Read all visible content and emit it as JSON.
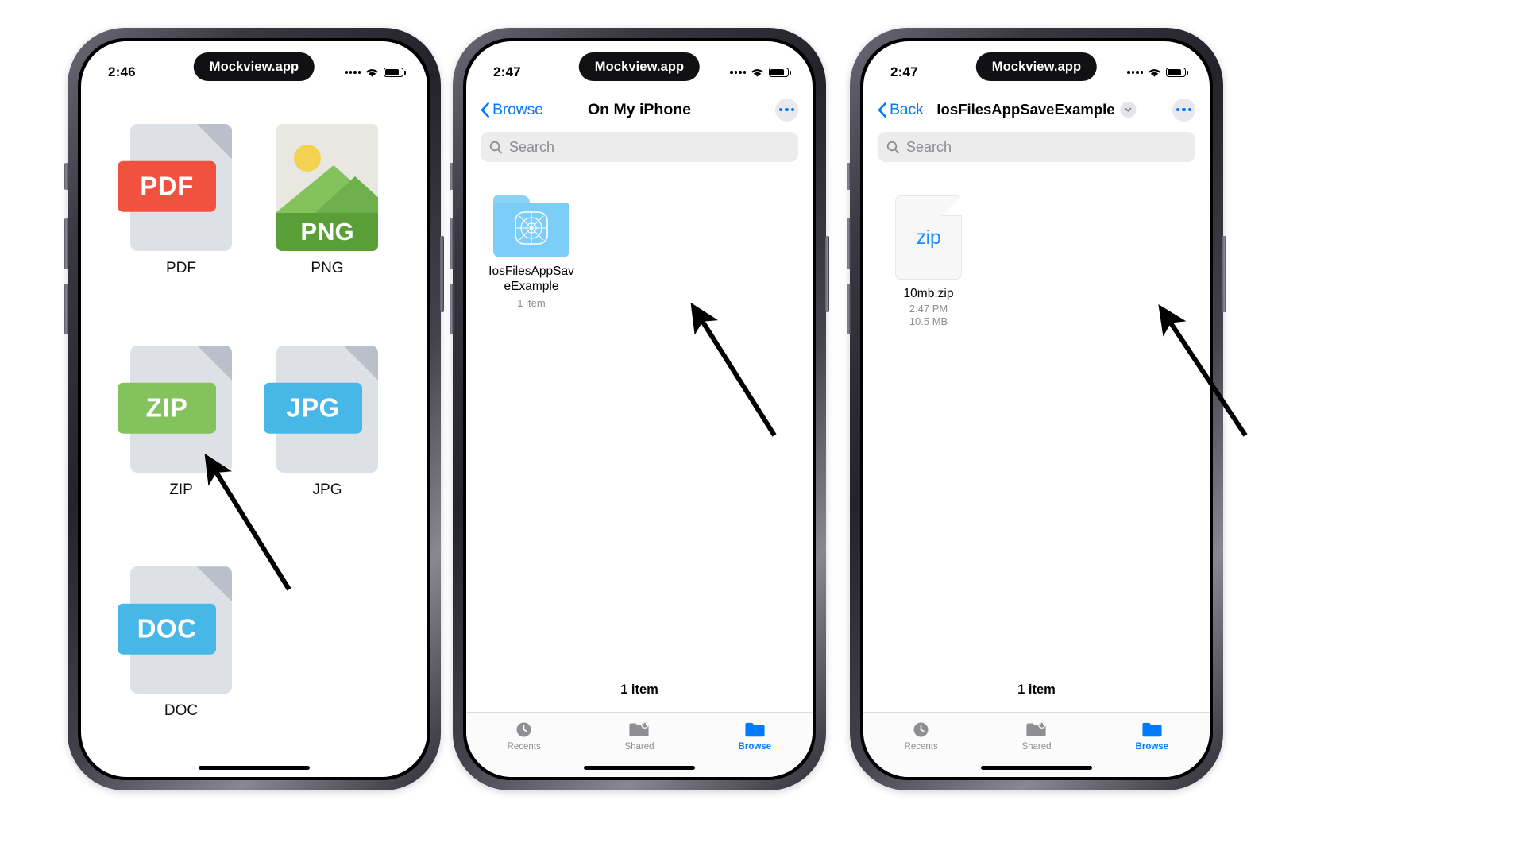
{
  "phones": [
    {
      "id": "phone-filetypes",
      "status": {
        "time": "2:46",
        "island_label": "Mockview.app",
        "wifi_icon": "wifi-icon",
        "battery_icon": "battery-icon",
        "signal_icon": "signal-dots-icon"
      },
      "filetypes": [
        {
          "label": "PDF",
          "badge": "PDF",
          "color": "#f0523f",
          "icon": "pdf-file-icon",
          "kind": "doc"
        },
        {
          "label": "PNG",
          "badge": "PNG",
          "color": "#5a9e38",
          "icon": "png-image-icon",
          "kind": "image"
        },
        {
          "label": "ZIP",
          "badge": "ZIP",
          "color": "#83c25d",
          "icon": "zip-file-icon",
          "kind": "doc"
        },
        {
          "label": "JPG",
          "badge": "JPG",
          "color": "#47b7e8",
          "icon": "jpg-file-icon",
          "kind": "doc"
        },
        {
          "label": "DOC",
          "badge": "DOC",
          "color": "#47b7e8",
          "icon": "doc-file-icon",
          "kind": "doc"
        }
      ]
    },
    {
      "id": "phone-on-my-iphone",
      "status": {
        "time": "2:47",
        "island_label": "Mockview.app",
        "wifi_icon": "wifi-icon",
        "battery_icon": "battery-icon",
        "signal_icon": "signal-dots-icon"
      },
      "nav": {
        "back_label": "Browse",
        "title": "On My iPhone",
        "more_icon": "ellipsis-circle-icon",
        "back_icon": "chevron-left-icon"
      },
      "search": {
        "placeholder": "Search",
        "icon": "search-icon"
      },
      "item": {
        "name": "IosFilesAppSaveExample",
        "subtitle": "1 item",
        "icon": "folder-icon"
      },
      "footer_count": "1 item",
      "tabs": [
        {
          "label": "Recents",
          "icon": "clock-icon",
          "active": false
        },
        {
          "label": "Shared",
          "icon": "shared-folder-icon",
          "active": false
        },
        {
          "label": "Browse",
          "icon": "folder-filled-icon",
          "active": true
        }
      ]
    },
    {
      "id": "phone-folder-contents",
      "status": {
        "time": "2:47",
        "island_label": "Mockview.app",
        "wifi_icon": "wifi-icon",
        "battery_icon": "battery-icon",
        "signal_icon": "signal-dots-icon"
      },
      "nav": {
        "back_label": "Back",
        "title": "IosFilesAppSaveExample",
        "more_icon": "ellipsis-circle-icon",
        "back_icon": "chevron-left-icon",
        "title_chevron_icon": "chevron-down-icon"
      },
      "search": {
        "placeholder": "Search",
        "icon": "search-icon"
      },
      "item": {
        "name": "10mb.zip",
        "time": "2:47 PM",
        "size": "10.5 MB",
        "icon": "zip-document-icon",
        "icon_label": "zip"
      },
      "footer_count": "1 item",
      "tabs": [
        {
          "label": "Recents",
          "icon": "clock-icon",
          "active": false
        },
        {
          "label": "Shared",
          "icon": "shared-folder-icon",
          "active": false
        },
        {
          "label": "Browse",
          "icon": "folder-filled-icon",
          "active": true
        }
      ]
    }
  ],
  "annotations": [
    {
      "name": "arrow-to-zip-filetype"
    },
    {
      "name": "arrow-to-folder"
    },
    {
      "name": "arrow-to-zip-file"
    }
  ],
  "colors": {
    "accent": "#027aff",
    "muted": "#8e8e93",
    "search_bg": "#ececed"
  }
}
